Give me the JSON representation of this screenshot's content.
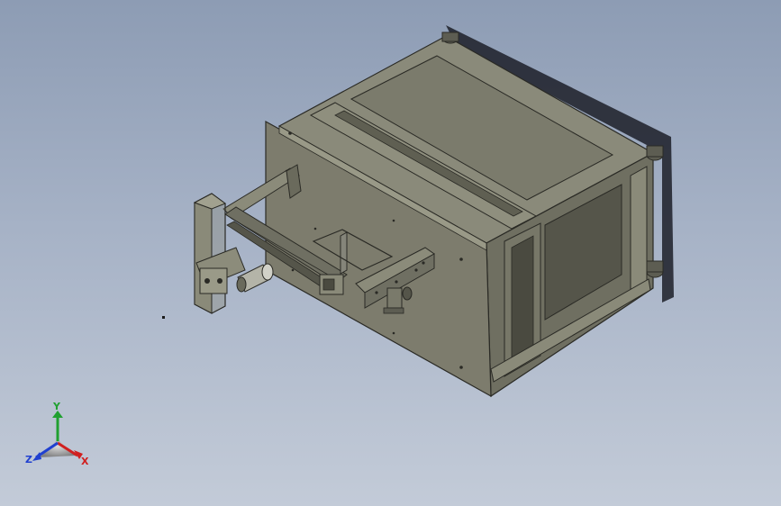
{
  "viewport": {
    "name": "solidworks-graphics-area",
    "background_top": "#8d9cb4",
    "background_bottom": "#c3cbd8"
  },
  "model": {
    "name": "frame-assembly-with-linear-gantry",
    "body_color": "#7f7e6f",
    "shadow_color": "#1c1f28"
  },
  "triad": {
    "x_label": "X",
    "y_label": "Y",
    "z_label": "Z",
    "x_color": "#d02020",
    "y_color": "#20a030",
    "z_color": "#2040d0"
  }
}
